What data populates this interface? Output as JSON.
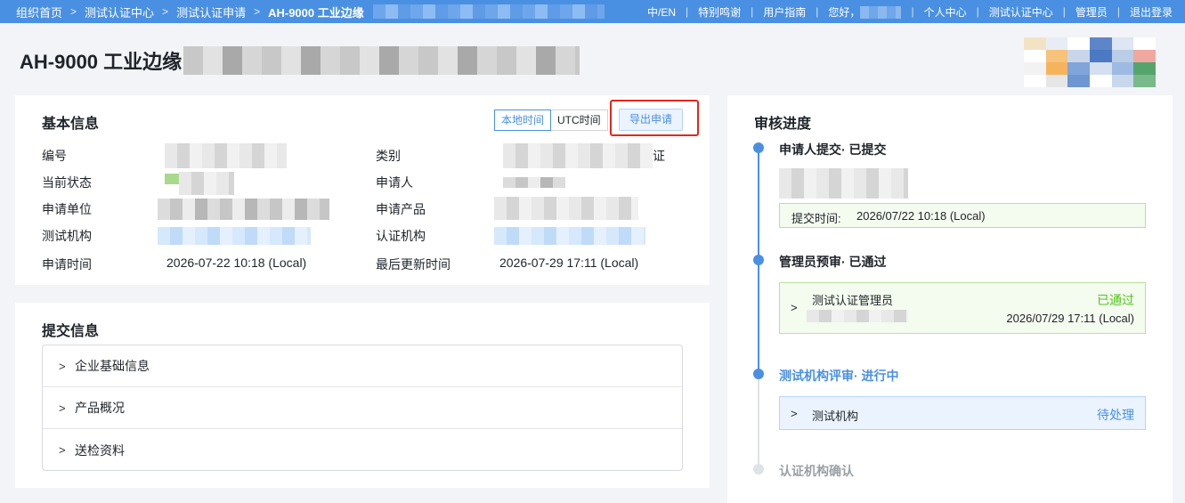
{
  "topbar": {
    "breadcrumbs": [
      "组织首页",
      "测试认证中心",
      "测试认证申请",
      "AH-9000 工业边缘"
    ],
    "nav": [
      "中/EN",
      "特别鸣谢",
      "用户指南",
      "您好，",
      "个人中心",
      "测试认证中心",
      "管理员",
      "退出登录"
    ]
  },
  "page": {
    "title": "AH-9000 工业边缘"
  },
  "basic_info": {
    "title": "基本信息",
    "time_toggle": [
      "本地时间",
      "UTC时间"
    ],
    "export_label": "导出申请",
    "fields": {
      "id_label": "编号",
      "category_label": "类别",
      "category_suffix": "证",
      "status_label": "当前状态",
      "applicant_label": "申请人",
      "org_label": "申请单位",
      "product_label": "申请产品",
      "test_org_label": "测试机构",
      "cert_org_label": "认证机构",
      "apply_time_label": "申请时间",
      "apply_time_value": "2026-07-22 10:18 (Local)",
      "updated_label": "最后更新时间",
      "updated_value": "2026-07-29 17:11 (Local)"
    }
  },
  "submit_info": {
    "title": "提交信息",
    "sections": [
      "企业基础信息",
      "产品概况",
      "送检资料"
    ]
  },
  "review": {
    "title": "审核进度",
    "steps": [
      {
        "title": "申请人提交· 已提交",
        "time_label": "提交时间:",
        "time_value": "2026/07/22 10:18 (Local)"
      },
      {
        "title": "管理员预审· 已通过",
        "reviewer": "测试认证管理员",
        "status": "已通过",
        "time": "2026/07/29 17:11 (Local)"
      },
      {
        "title": "测试机构评审· 进行中",
        "org": "测试机构",
        "status": "待处理"
      },
      {
        "title": "认证机构确认"
      }
    ]
  },
  "colors": {
    "accent": "#4a90e2",
    "success": "#52c41a",
    "highlight": "#e4261d"
  }
}
